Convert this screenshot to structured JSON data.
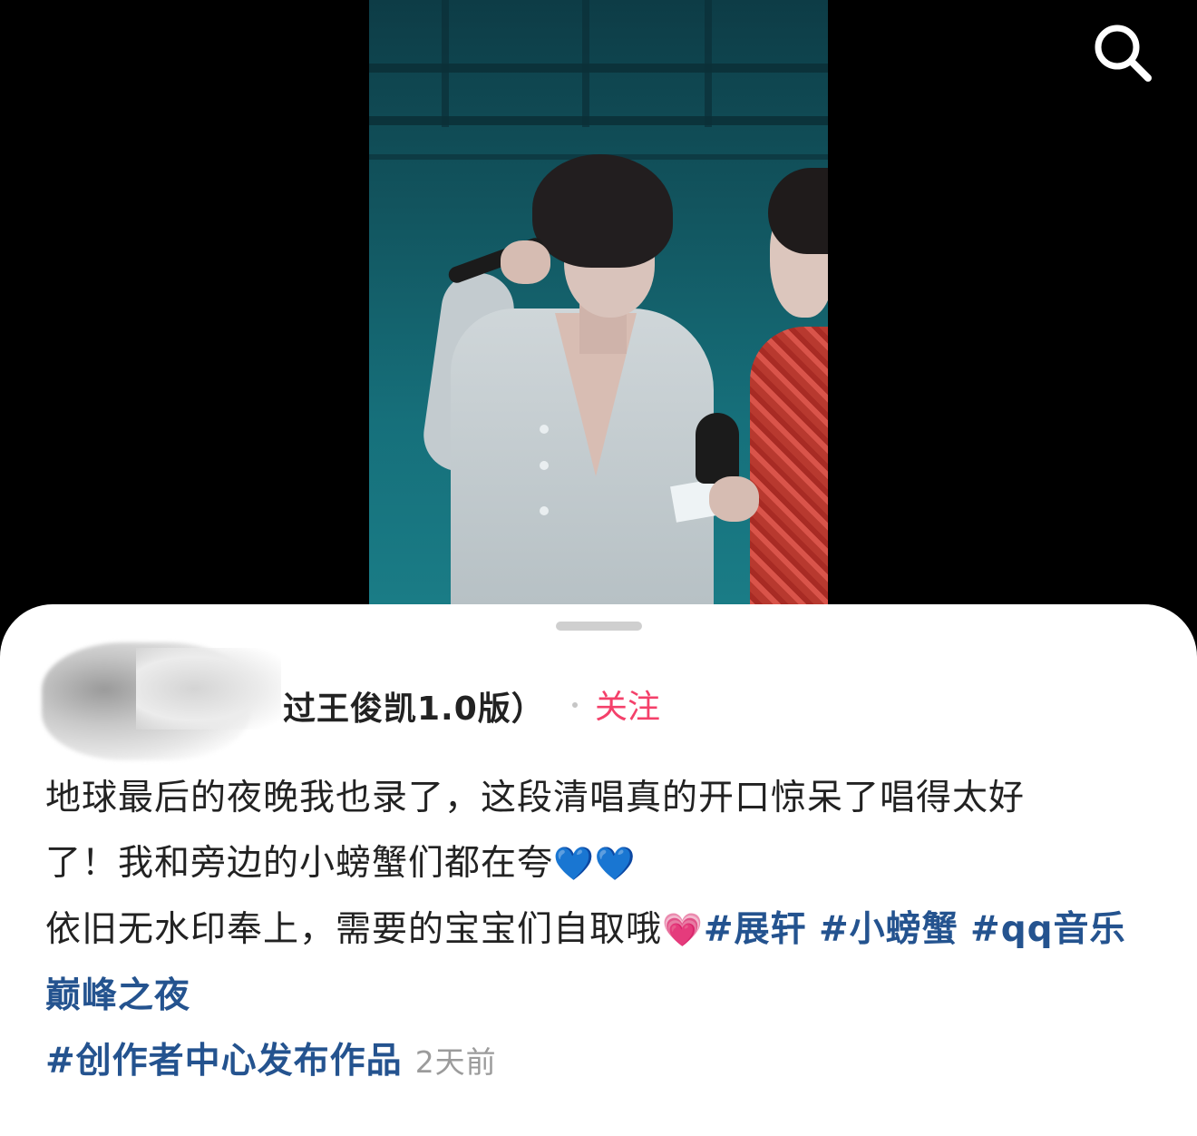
{
  "header": {
    "search_icon": "search-icon"
  },
  "post": {
    "author_name": "过王俊凯1.0版）",
    "follow_label": "关注",
    "line1": "地球最后的夜晚我也录了，这段清唱真的开口惊呆了唱得太好",
    "line2": "了！我和旁边的小螃蟹们都在夸",
    "line2_emoji": "💙💙",
    "line3": "依旧无水印奉上，需要的宝宝们自取哦",
    "line3_emoji": "💗",
    "tags": [
      "#展轩",
      "#小螃蟹",
      "#qq音乐巅峰之夜",
      "#创作者中心发布作品"
    ],
    "time": "2天前"
  },
  "colors": {
    "tag": "#24538f",
    "follow": "#f4406a",
    "time": "#9b9b9b"
  }
}
